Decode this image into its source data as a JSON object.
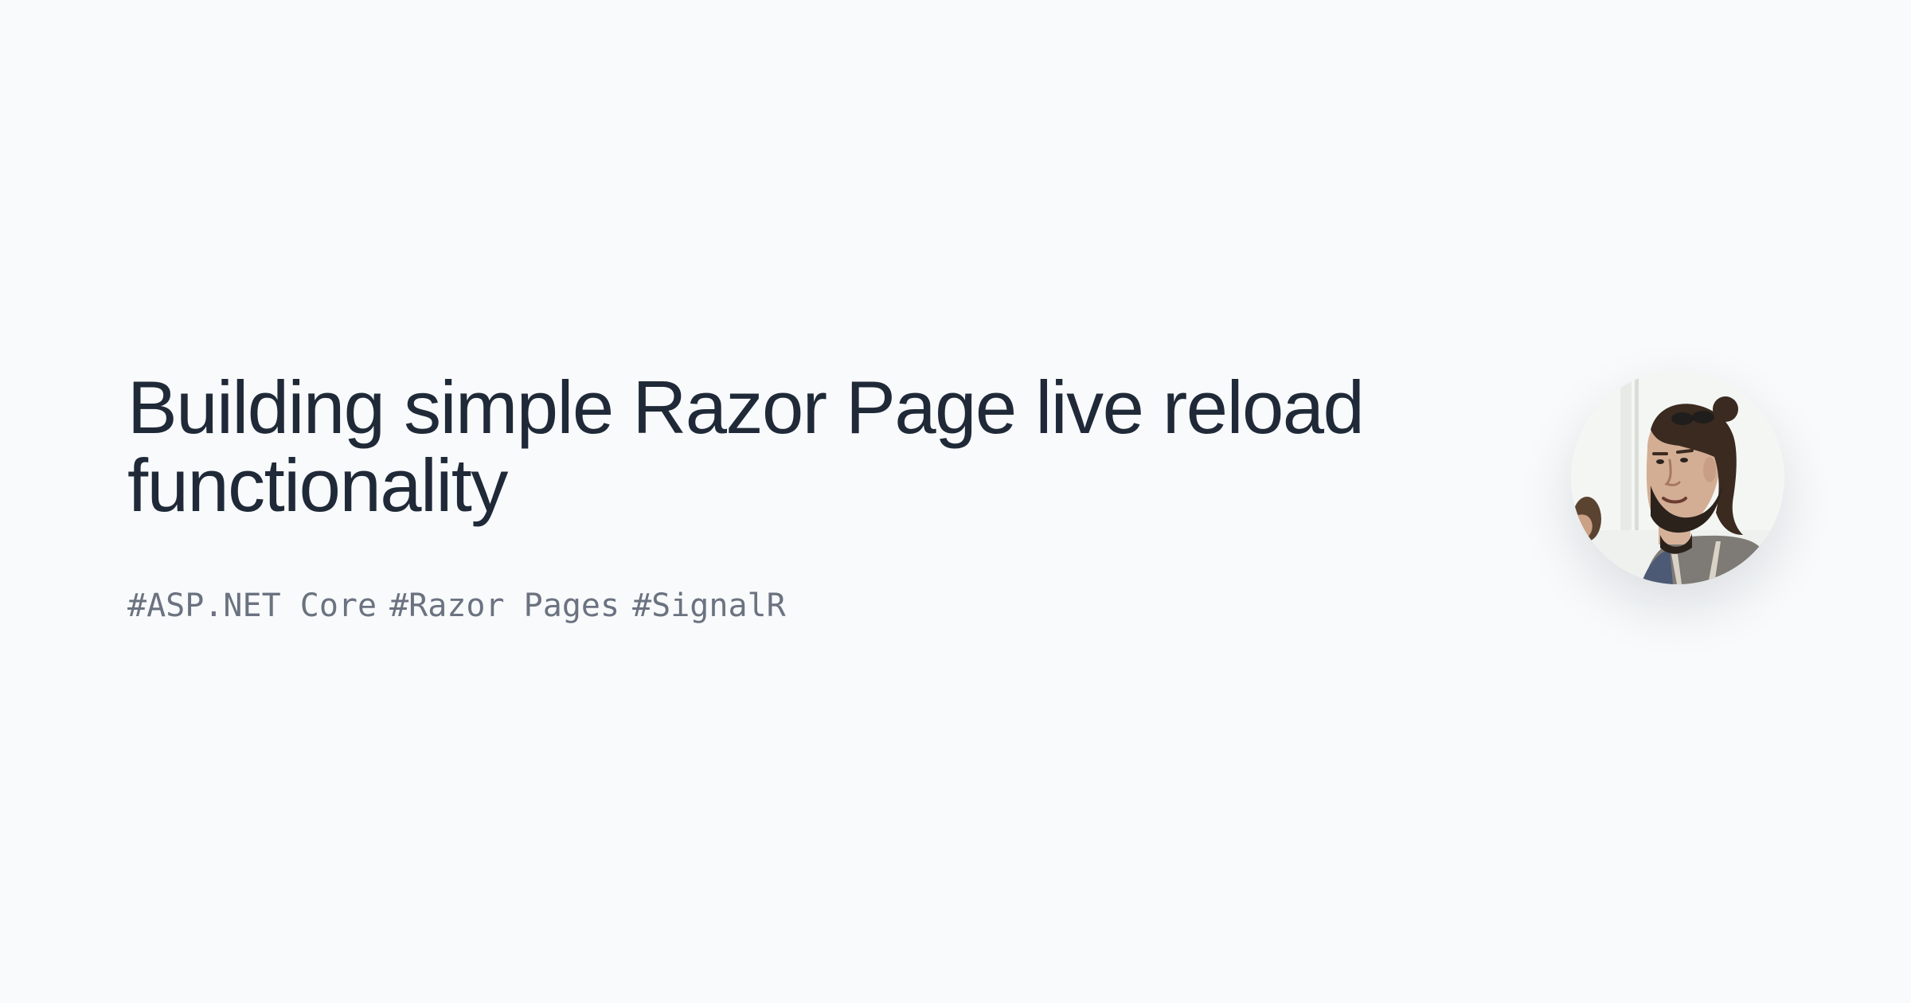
{
  "post": {
    "title": "Building simple Razor Page live reload functionality",
    "tags": [
      {
        "label": "#ASP.NET Core"
      },
      {
        "label": "#Razor Pages"
      },
      {
        "label": "#SignalR"
      }
    ]
  },
  "author": {
    "avatar": "author-photo"
  },
  "colors": {
    "background": "#f8fafb",
    "title": "#1f2937",
    "tags": "#6b7280"
  }
}
